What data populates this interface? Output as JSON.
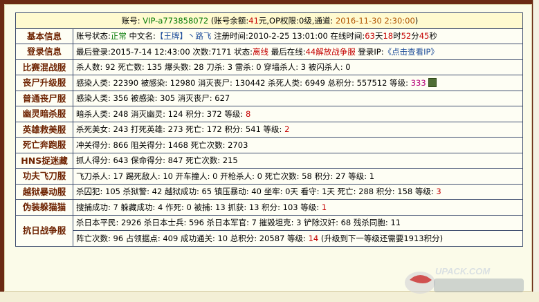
{
  "top": {
    "account_label": "账号:",
    "account": "VIP-a773858072",
    "balance_label": "(账号余额:",
    "balance": "41",
    "balance_unit": "元,OP权限:",
    "op_level": "0",
    "level_unit": "级,通道:",
    "date": "2016-11-30 2:30:00",
    "close_paren": ")"
  },
  "rows": {
    "basic": {
      "head": "基本信息",
      "status_label": "账号状态:",
      "status": "正常",
      "cn_label": "中文名:",
      "cn_name": "【王牌】丶路飞",
      "reg_label": "注册时间:",
      "reg_time": "2010-2-25 13:01:00",
      "online_label": "在线时间:",
      "days": "63",
      "d": "天",
      "hours": "18",
      "h": "时",
      "minutes": "52",
      "m": "分",
      "seconds": "45",
      "s": "秒"
    },
    "login": {
      "head": "登录信息",
      "last_label": "最后登录:",
      "last": "2015-7-14 12:43:00",
      "count_label": "次数:",
      "count": "7171",
      "state_label": "状态:",
      "state": "离线",
      "last_online_label": "最后在线:",
      "last_online": "44解放战争服",
      "ip_label": "登录IP:",
      "ip_link": "《点击查看IP》"
    },
    "match": {
      "head": "比赛混战服",
      "text": "杀人数: 92 死亡数: 135 爆头数: 28 刀杀: 3 雷杀: 0 穿墙杀人: 3 被闪杀人: 0"
    },
    "zombie_up": {
      "head": "丧尸升级服",
      "text": "感染人类: 22390 被感染: 12980 消灭丧尸: 130442 杀死人类: 6949 总积分: 557512 等级:",
      "level": "333"
    },
    "zombie": {
      "head": "普通丧尸服",
      "text": "感染人类: 356 被感染: 305 消灭丧尸: 627"
    },
    "ghost": {
      "head": "幽灵暗杀服",
      "text": "暗杀人类: 248 消灭幽灵: 124 积分: 372 等级:",
      "level": "8"
    },
    "hero": {
      "head": "英雄救美服",
      "text": "杀死美女: 243 打死英雄: 273 死亡: 172 积分: 541 等级:",
      "level": "2"
    },
    "death_run": {
      "head": "死亡奔跑服",
      "text": "冲关得分: 866 阻关得分: 1468 死亡次数: 2703"
    },
    "hide": {
      "head": "HNS捉迷藏",
      "text": "抓人得分: 643 保命得分: 847 死亡次数: 215"
    },
    "kungfu": {
      "head": "功夫飞刀服",
      "text": "飞刀杀人: 17 踢死敌人: 10 开车撞人: 0 开枪杀人: 0 死亡次数: 58 积分: 27 等级: 1"
    },
    "jail": {
      "head": "越狱暴动服",
      "text": "杀囚犯: 105 杀狱警: 42 越狱成功: 65 镇压暴动: 40 坐牢: 0天 看守: 1天 死亡: 288 积分: 158 等级:",
      "level": "3"
    },
    "prop_hunt": {
      "head": "伪装躲猫猫",
      "text": "搜捕成功: 7 躲藏成功: 4 作死: 0 被捕: 13 抓获: 13 积分: 103 等级:",
      "level": "1"
    },
    "war": {
      "head": "抗日战争服",
      "line1": "杀日本平民: 2926 杀日本士兵: 596 杀日本军官: 7 摧毁坦克: 3 铲除汉奸: 68 残杀同胞: 11",
      "line2": "阵亡次数: 96 占领据点: 409 成功通关: 10 总积分: 20587 等级:",
      "level": "14",
      "note": "(升级到下一等级还需要1913积分)"
    }
  },
  "watermark": {
    "text": "UPACK.COM"
  }
}
